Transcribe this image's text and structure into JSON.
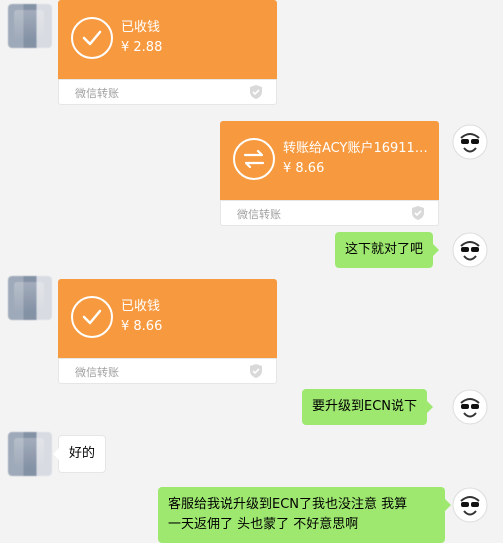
{
  "chat": {
    "msg1": {
      "status": "已收钱",
      "amount": "¥ 2.88",
      "footer": "微信转账"
    },
    "msg2": {
      "title": "转账给ACY账户16911…",
      "amount": "¥ 8.66",
      "footer": "微信转账"
    },
    "msg3": {
      "text": "这下就对了吧"
    },
    "msg4": {
      "status": "已收钱",
      "amount": "¥ 8.66",
      "footer": "微信转账"
    },
    "msg5": {
      "text": "要升级到ECN说下"
    },
    "msg6": {
      "text": "好的"
    },
    "msg7": {
      "line1": "客服给我说升级到ECN了我也没注意  我算",
      "line2": "一天返佣了 头也蒙了   不好意思啊"
    }
  },
  "colors": {
    "transfer_orange": "#f79a3f",
    "sent_bubble_green": "#9ee870",
    "background": "#f3f3f3"
  },
  "icons": [
    "check-circle-icon",
    "transfer-arrows-icon",
    "shield-icon",
    "avatar"
  ]
}
